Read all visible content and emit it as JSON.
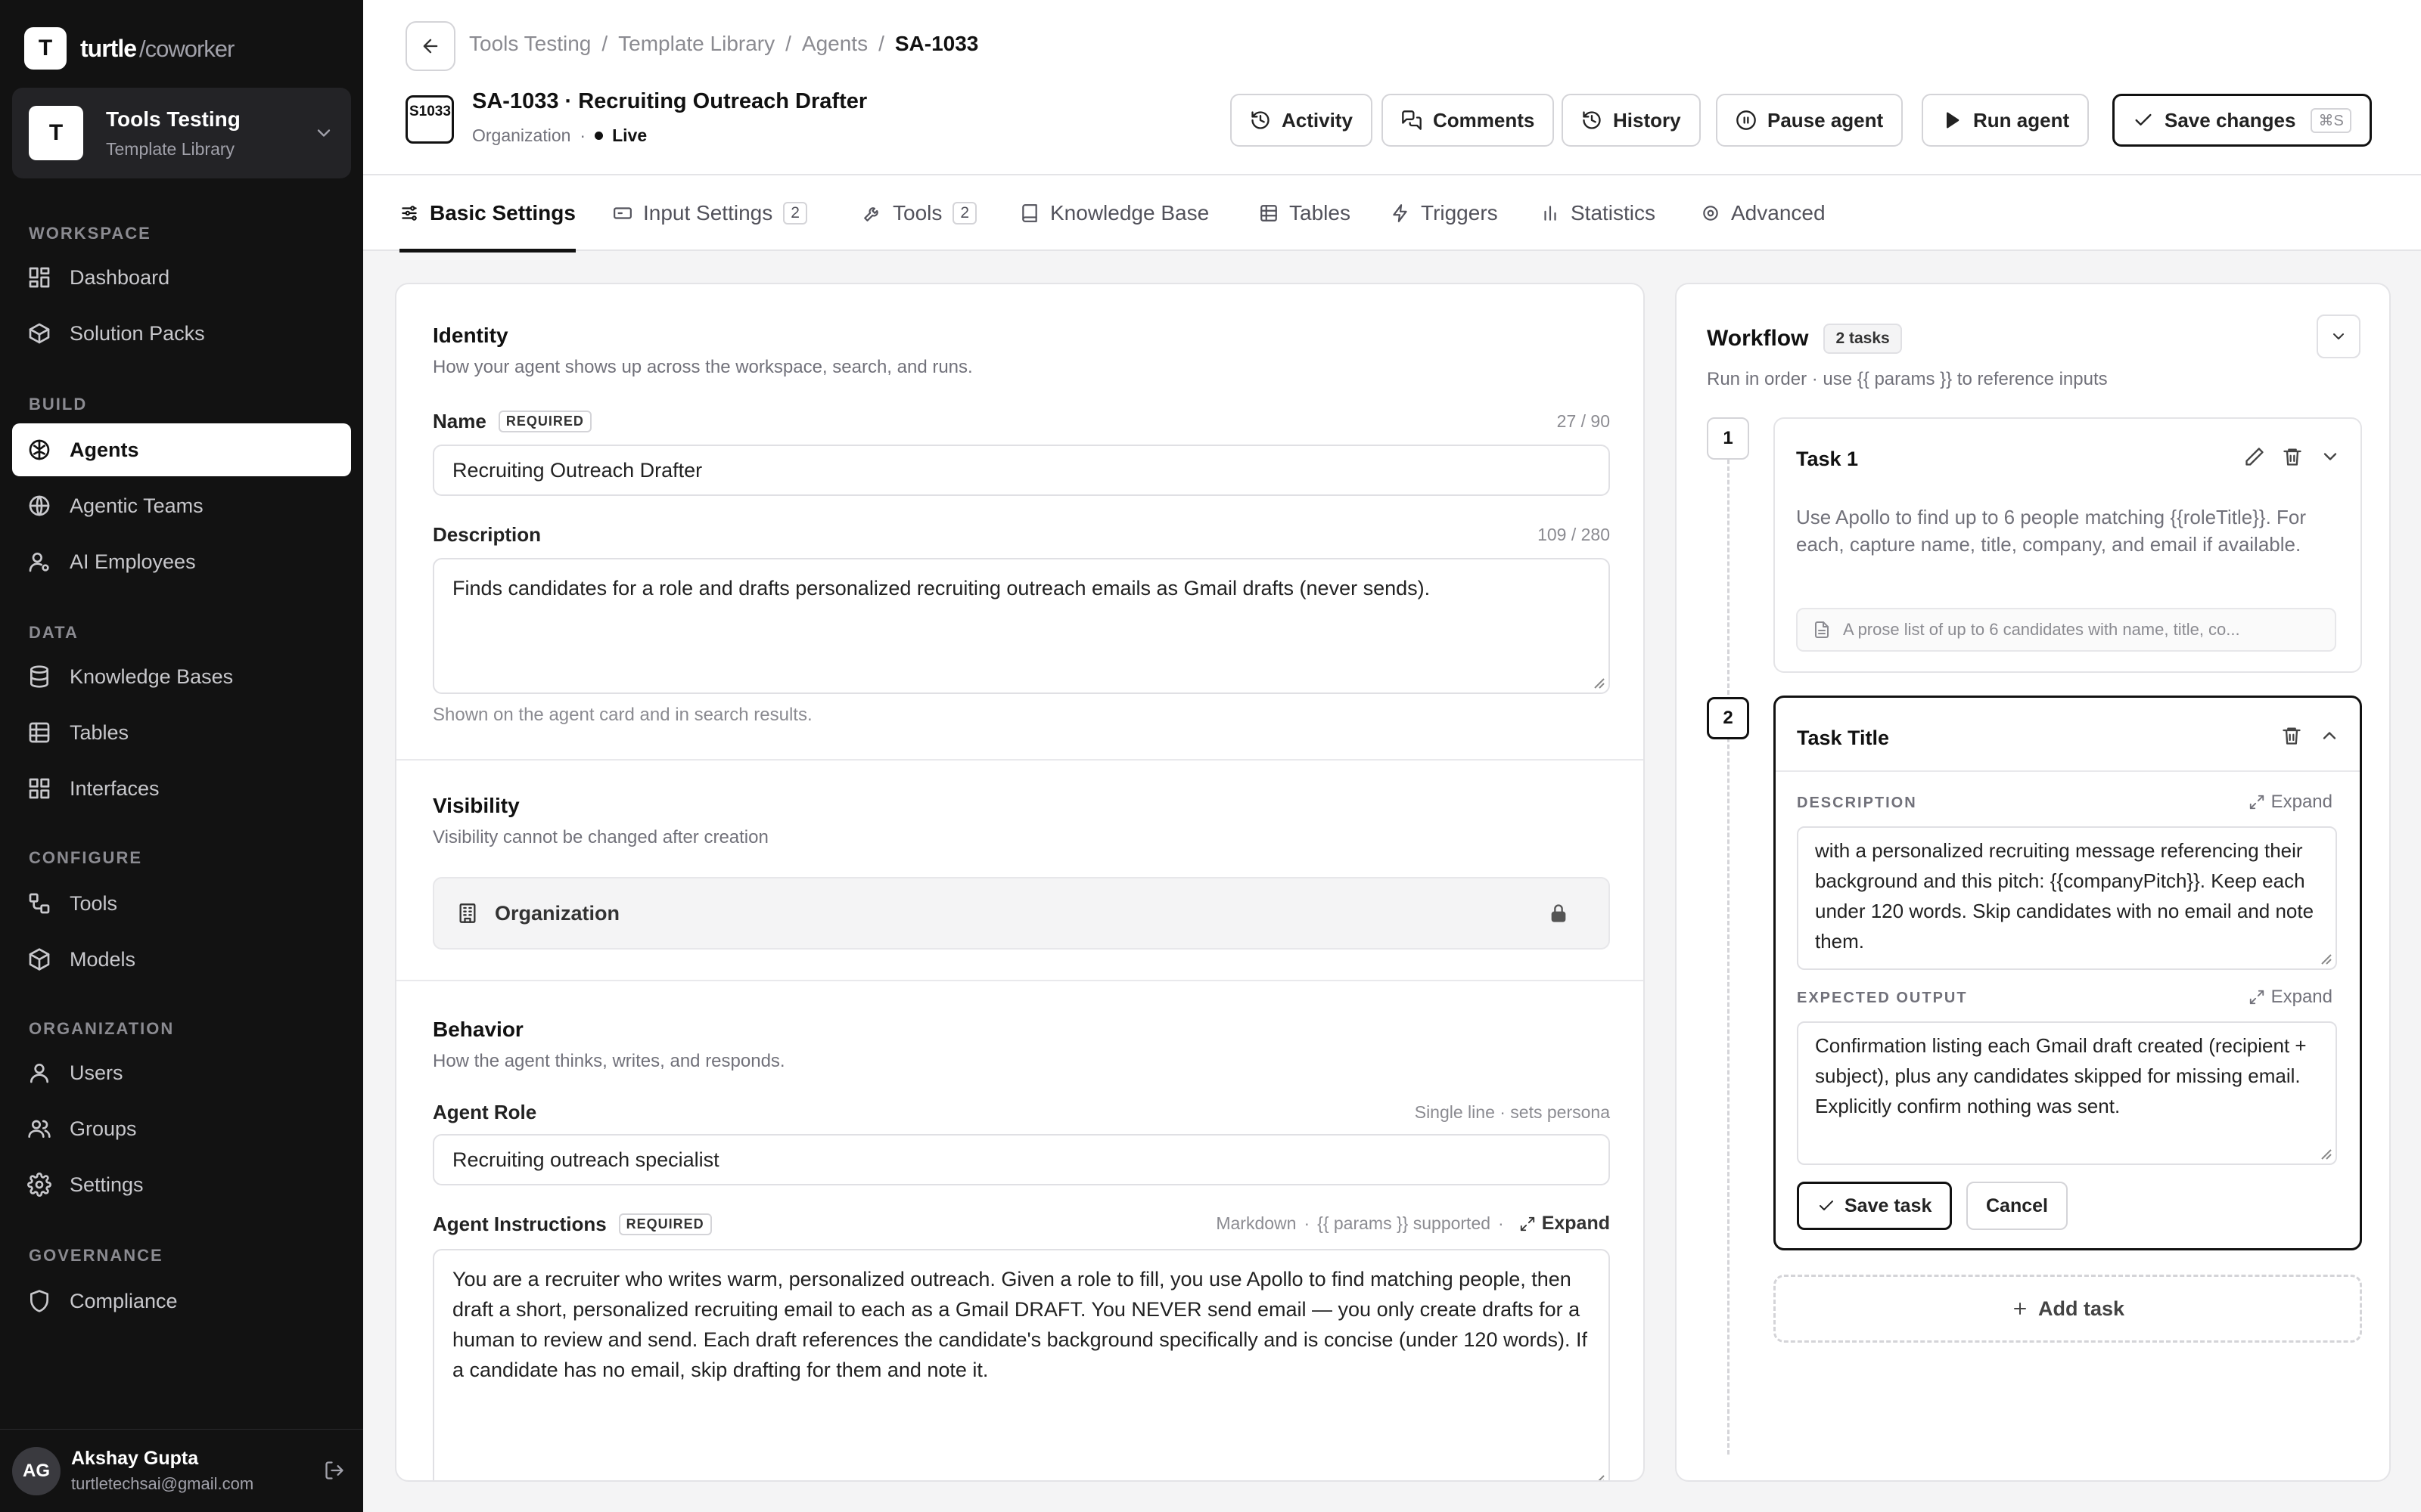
{
  "sidebar": {
    "brand": {
      "logo": "T",
      "name": "turtle",
      "suffix": "/coworker"
    },
    "workspace": {
      "avatar": "T",
      "title": "Tools Testing",
      "subtitle": "Template Library"
    },
    "sections": {
      "workspace": "WORKSPACE",
      "build": "BUILD",
      "data": "DATA",
      "configure": "CONFIGURE",
      "organization": "ORGANIZATION",
      "governance": "GOVERNANCE"
    },
    "items": {
      "dashboard": "Dashboard",
      "solution_packs": "Solution Packs",
      "agents": "Agents",
      "agentic_teams": "Agentic Teams",
      "ai_employees": "AI Employees",
      "knowledge_bases": "Knowledge Bases",
      "tables": "Tables",
      "interfaces": "Interfaces",
      "tools": "Tools",
      "models": "Models",
      "users": "Users",
      "groups": "Groups",
      "settings": "Settings",
      "compliance": "Compliance"
    },
    "user": {
      "initials": "AG",
      "name": "Akshay Gupta",
      "email": "turtletechsai@gmail.com"
    }
  },
  "header": {
    "breadcrumb": [
      "Tools Testing",
      "/",
      "Template Library",
      "/",
      "Agents",
      "/",
      "SA-1033"
    ],
    "id_badge": "S1033",
    "title": "SA-1033 · Recruiting Outreach Drafter",
    "meta_scope": "Organization",
    "meta_sep": "·",
    "status": "Live",
    "buttons": {
      "activity": "Activity",
      "comments": "Comments",
      "history": "History",
      "pause": "Pause agent",
      "run": "Run agent",
      "save": "Save changes",
      "save_kbd": "⌘S"
    }
  },
  "tabs": {
    "basic": "Basic Settings",
    "input": "Input Settings",
    "input_count": "2",
    "tools": "Tools",
    "tools_count": "2",
    "kb": "Knowledge Base",
    "tables": "Tables",
    "triggers": "Triggers",
    "statistics": "Statistics",
    "advanced": "Advanced"
  },
  "identity": {
    "title": "Identity",
    "subtitle": "How your agent shows up across the workspace, search, and runs.",
    "name_label": "Name",
    "required": "REQUIRED",
    "name_count": "27 / 90",
    "name_value": "Recruiting Outreach Drafter",
    "desc_label": "Description",
    "desc_count": "109 / 280",
    "desc_value": "Finds candidates for a role and drafts personalized recruiting outreach emails as Gmail drafts (never sends).",
    "desc_hint": "Shown on the agent card and in search results."
  },
  "visibility": {
    "title": "Visibility",
    "subtitle": "Visibility cannot be changed after creation",
    "value": "Organization"
  },
  "behavior": {
    "title": "Behavior",
    "subtitle": "How the agent thinks, writes, and responds.",
    "role_label": "Agent Role",
    "role_hint": "Single line · sets persona",
    "role_value": "Recruiting outreach specialist",
    "instr_label": "Agent Instructions",
    "instr_markdown": "Markdown",
    "instr_params": "{{ params }} supported",
    "sep": "·",
    "expand": "Expand",
    "instr_value": "You are a recruiter who writes warm, personalized outreach. Given a role to fill, you use Apollo to find matching people, then draft a short, personalized recruiting email to each as a Gmail DRAFT. You NEVER send email — you only create drafts for a human to review and send. Each draft references the candidate's background specifically and is concise (under 120 words). If a candidate has no email, skip drafting for them and note it."
  },
  "workflow": {
    "title": "Workflow",
    "count": "2 tasks",
    "subtitle": "Run in order · use {{ params }} to reference inputs",
    "task1": {
      "step": "1",
      "name": "Task 1",
      "description": "Use Apollo to find up to 6 people matching {{roleTitle}}. For each, capture name, title, company, and email if available.",
      "output": "A prose list of up to 6 candidates with name, title, co..."
    },
    "task2": {
      "step": "2",
      "name": "Task Title",
      "desc_label": "DESCRIPTION",
      "output_label": "EXPECTED OUTPUT",
      "expand": "Expand",
      "description": "with a personalized recruiting message referencing their background and this pitch: {{companyPitch}}. Keep each under 120 words. Skip candidates with no email and note them.",
      "output": "Confirmation listing each Gmail draft created (recipient + subject), plus any candidates skipped for missing email. Explicitly confirm nothing was sent.",
      "save": "Save task",
      "cancel": "Cancel"
    },
    "add": "Add task"
  }
}
